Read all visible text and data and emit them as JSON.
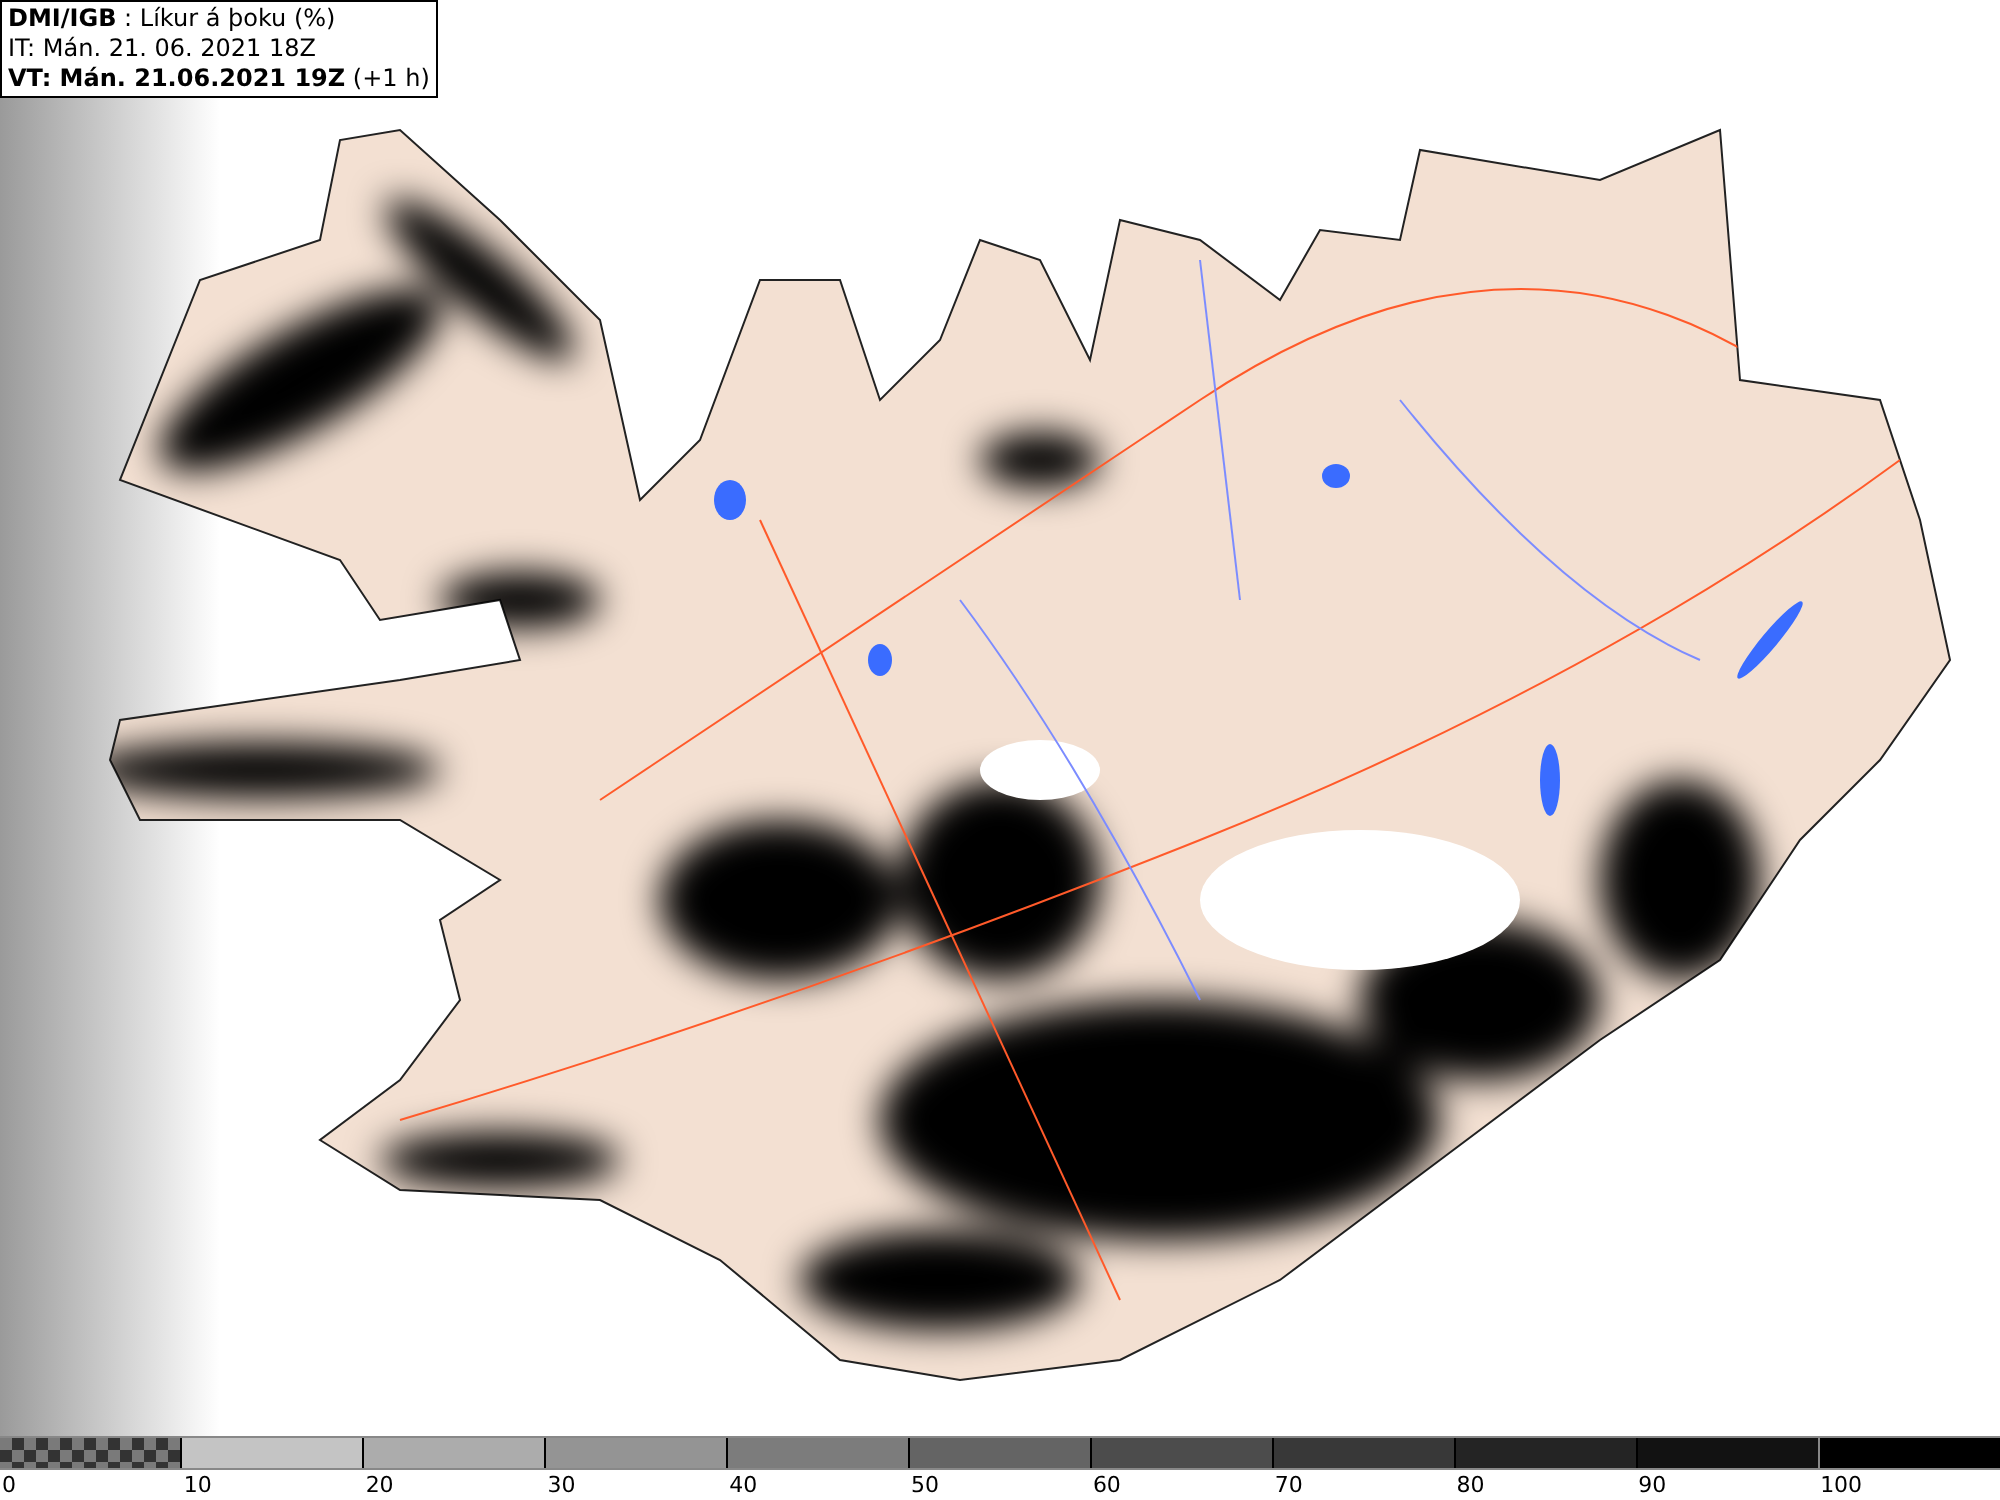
{
  "header": {
    "lines": [
      "**DMI/IGB** : Líkur á þoku (%)",
      "IT: Mán. 21. 06. 2021 18Z",
      "**VT: Mán. 21.06.2021 19Z** (+1 h)"
    ]
  },
  "legend": {
    "segments": [
      {
        "kind": "checker",
        "color": "#7a7a7a"
      },
      {
        "kind": "solid",
        "color": "#c4c4c4"
      },
      {
        "kind": "solid",
        "color": "#acacac"
      },
      {
        "kind": "solid",
        "color": "#949494"
      },
      {
        "kind": "solid",
        "color": "#7c7c7c"
      },
      {
        "kind": "solid",
        "color": "#646464"
      },
      {
        "kind": "solid",
        "color": "#4c4c4c"
      },
      {
        "kind": "solid",
        "color": "#383838"
      },
      {
        "kind": "solid",
        "color": "#242424"
      },
      {
        "kind": "solid",
        "color": "#121212"
      },
      {
        "kind": "solid",
        "color": "#000000"
      }
    ],
    "labels": [
      "0",
      "10",
      "20",
      "30",
      "40",
      "50",
      "60",
      "70",
      "80",
      "90",
      "100"
    ]
  }
}
